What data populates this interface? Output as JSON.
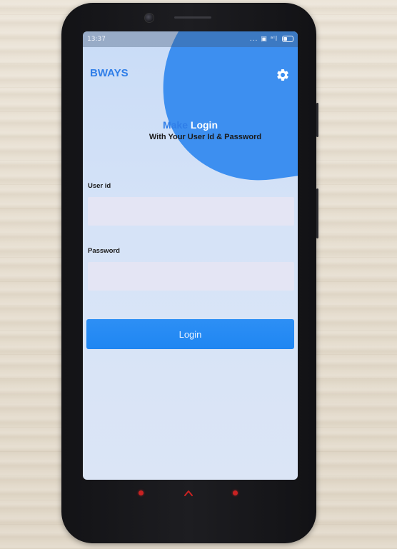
{
  "status_bar": {
    "time": "13:37",
    "indicators": "... ▣ ᵃˡl"
  },
  "app": {
    "title": "BWAYS",
    "settings_icon": "gear-icon"
  },
  "heading": {
    "main_part1": "Make ",
    "main_part2": "Login",
    "subtitle": "With Your User Id & Password"
  },
  "form": {
    "user_label": "User id",
    "user_value": "",
    "password_label": "Password",
    "password_value": "",
    "login_label": "Login"
  },
  "colors": {
    "accent": "#2f7ee8",
    "button": "#2088f3",
    "input_bg": "#e4e5f4",
    "blob": "#3d8ff0",
    "nav_keys": "#c92222"
  },
  "nav_bar": {
    "left_icon": "menu-icon",
    "center_icon": "home-icon",
    "right_icon": "back-icon"
  }
}
